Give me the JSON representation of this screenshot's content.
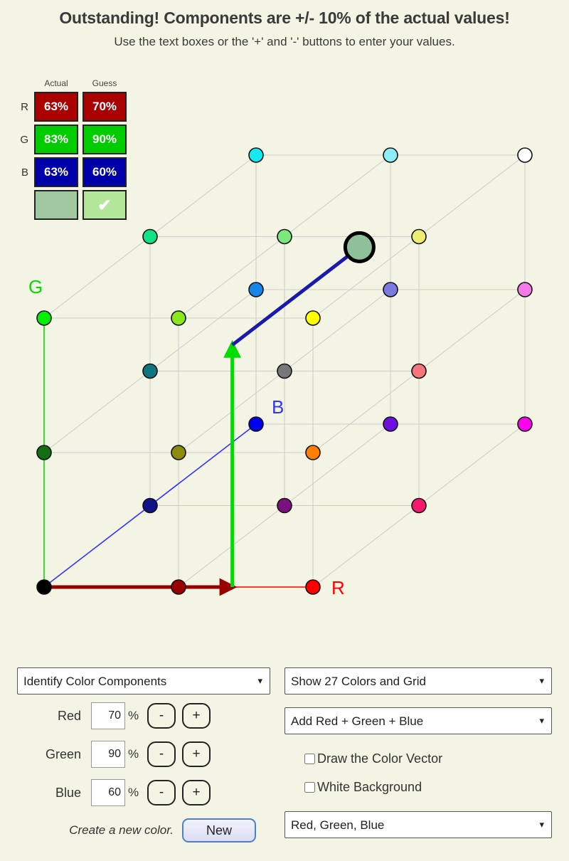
{
  "header": {
    "title": "Outstanding! Components are +/- 10% of the actual values!",
    "subtitle": "Use the text boxes or the '+' and '-' buttons to enter your values."
  },
  "readout": {
    "col_actual": "Actual",
    "col_guess": "Guess",
    "rows": [
      {
        "label": "R",
        "actual": "63%",
        "guess": "70%"
      },
      {
        "label": "G",
        "actual": "83%",
        "guess": "90%"
      },
      {
        "label": "B",
        "actual": "63%",
        "guess": "60%"
      }
    ],
    "actual_swatch_color": "#a1c8a1",
    "guess_swatch_color": "#b3e699",
    "check_glyph": "✔"
  },
  "cube": {
    "axis_labels": {
      "red": "R",
      "green": "G",
      "blue": "B"
    },
    "axis_colors": {
      "red": "#ff0000",
      "green": "#00dd00",
      "blue": "#3333ff"
    },
    "background": "#f3f4e4",
    "grid_color": "#cccccc",
    "target_marker_color": "#8fc09a",
    "vector": {
      "red_leg_color": "#990000",
      "green_leg_color": "#00dd00",
      "blue_leg_color": "#1a1aaa",
      "red_fraction": 0.7,
      "green_fraction": 0.9,
      "blue_fraction": 0.6
    },
    "nodes": [
      {
        "name": "black",
        "r": 0.0,
        "g": 0.0,
        "b": 0.0,
        "color": "#000000"
      },
      {
        "name": "dark-red",
        "r": 0.5,
        "g": 0.0,
        "b": 0.0,
        "color": "#990000"
      },
      {
        "name": "red",
        "r": 1.0,
        "g": 0.0,
        "b": 0.0,
        "color": "#ff0000"
      },
      {
        "name": "dark-green",
        "r": 0.0,
        "g": 0.5,
        "b": 0.0,
        "color": "#136d13"
      },
      {
        "name": "olive",
        "r": 0.5,
        "g": 0.5,
        "b": 0.0,
        "color": "#8b8b10"
      },
      {
        "name": "orange",
        "r": 1.0,
        "g": 0.5,
        "b": 0.0,
        "color": "#ff8000"
      },
      {
        "name": "green",
        "r": 0.0,
        "g": 1.0,
        "b": 0.0,
        "color": "#00ee00"
      },
      {
        "name": "yellow-green",
        "r": 0.5,
        "g": 1.0,
        "b": 0.0,
        "color": "#8ae61f"
      },
      {
        "name": "yellow",
        "r": 1.0,
        "g": 1.0,
        "b": 0.0,
        "color": "#ffff00"
      },
      {
        "name": "navy",
        "r": 0.0,
        "g": 0.0,
        "b": 0.5,
        "color": "#131389"
      },
      {
        "name": "dark-purple",
        "r": 0.5,
        "g": 0.0,
        "b": 0.5,
        "color": "#7b1080"
      },
      {
        "name": "deep-pink",
        "r": 1.0,
        "g": 0.0,
        "b": 0.5,
        "color": "#f5196e"
      },
      {
        "name": "teal",
        "r": 0.0,
        "g": 0.5,
        "b": 0.5,
        "color": "#10757f"
      },
      {
        "name": "gray",
        "r": 0.5,
        "g": 0.5,
        "b": 0.5,
        "color": "#777777"
      },
      {
        "name": "salmon",
        "r": 1.0,
        "g": 0.5,
        "b": 0.5,
        "color": "#f4757a"
      },
      {
        "name": "spring-green",
        "r": 0.0,
        "g": 1.0,
        "b": 0.5,
        "color": "#13e283"
      },
      {
        "name": "light-green",
        "r": 0.5,
        "g": 1.0,
        "b": 0.5,
        "color": "#7ae87a"
      },
      {
        "name": "light-yellow",
        "r": 1.0,
        "g": 1.0,
        "b": 0.5,
        "color": "#ecec72"
      },
      {
        "name": "blue",
        "r": 0.0,
        "g": 0.0,
        "b": 1.0,
        "color": "#0000ee"
      },
      {
        "name": "violet",
        "r": 0.5,
        "g": 0.0,
        "b": 1.0,
        "color": "#7010e0"
      },
      {
        "name": "magenta",
        "r": 1.0,
        "g": 0.0,
        "b": 1.0,
        "color": "#ff00ee"
      },
      {
        "name": "dodger-blue",
        "r": 0.0,
        "g": 0.5,
        "b": 1.0,
        "color": "#1585e8"
      },
      {
        "name": "periwinkle",
        "r": 0.5,
        "g": 0.5,
        "b": 1.0,
        "color": "#7a7ae0"
      },
      {
        "name": "orchid",
        "r": 1.0,
        "g": 0.5,
        "b": 1.0,
        "color": "#f57ae8"
      },
      {
        "name": "cyan",
        "r": 0.0,
        "g": 1.0,
        "b": 1.0,
        "color": "#14e8f0"
      },
      {
        "name": "pale-cyan",
        "r": 0.5,
        "g": 1.0,
        "b": 1.0,
        "color": "#8af0f5"
      },
      {
        "name": "white",
        "r": 1.0,
        "g": 1.0,
        "b": 1.0,
        "color": "#ffffff"
      }
    ]
  },
  "controls": {
    "mode_select": {
      "value": "Identify Color Components"
    },
    "red": {
      "label": "Red",
      "value": "70",
      "unit": "%",
      "minus": "-",
      "plus": "+"
    },
    "green": {
      "label": "Green",
      "value": "90",
      "unit": "%",
      "minus": "-",
      "plus": "+"
    },
    "blue": {
      "label": "Blue",
      "value": "60",
      "unit": "%",
      "minus": "-",
      "plus": "+"
    },
    "new_caption": "Create a new color.",
    "new_button": "New",
    "display_select": {
      "value": "Show 27 Colors and Grid"
    },
    "add_select": {
      "value": "Add Red + Green + Blue"
    },
    "draw_vector_checkbox": {
      "label": "Draw the Color Vector",
      "checked": false
    },
    "white_background_checkbox": {
      "label": "White Background",
      "checked": false
    },
    "channels_select": {
      "value": "Red, Green, Blue"
    },
    "caret_glyph": "❯"
  }
}
